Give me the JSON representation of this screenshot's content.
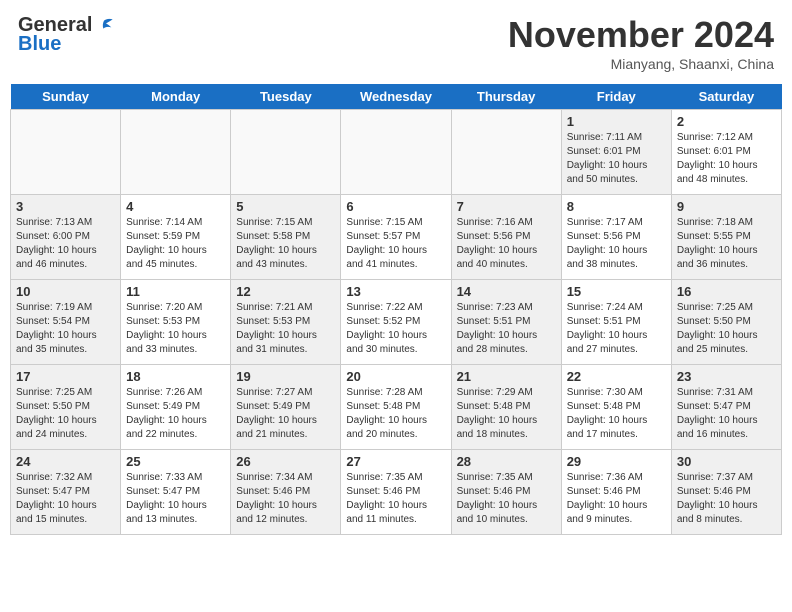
{
  "header": {
    "logo_general": "General",
    "logo_blue": "Blue",
    "month_title": "November 2024",
    "location": "Mianyang, Shaanxi, China"
  },
  "days_of_week": [
    "Sunday",
    "Monday",
    "Tuesday",
    "Wednesday",
    "Thursday",
    "Friday",
    "Saturday"
  ],
  "weeks": [
    [
      {
        "day": "",
        "info": "",
        "empty": true
      },
      {
        "day": "",
        "info": "",
        "empty": true
      },
      {
        "day": "",
        "info": "",
        "empty": true
      },
      {
        "day": "",
        "info": "",
        "empty": true
      },
      {
        "day": "",
        "info": "",
        "empty": true
      },
      {
        "day": "1",
        "info": "Sunrise: 7:11 AM\nSunset: 6:01 PM\nDaylight: 10 hours\nand 50 minutes.",
        "shaded": true
      },
      {
        "day": "2",
        "info": "Sunrise: 7:12 AM\nSunset: 6:01 PM\nDaylight: 10 hours\nand 48 minutes.",
        "shaded": false
      }
    ],
    [
      {
        "day": "3",
        "info": "Sunrise: 7:13 AM\nSunset: 6:00 PM\nDaylight: 10 hours\nand 46 minutes.",
        "shaded": true
      },
      {
        "day": "4",
        "info": "Sunrise: 7:14 AM\nSunset: 5:59 PM\nDaylight: 10 hours\nand 45 minutes.",
        "shaded": false
      },
      {
        "day": "5",
        "info": "Sunrise: 7:15 AM\nSunset: 5:58 PM\nDaylight: 10 hours\nand 43 minutes.",
        "shaded": true
      },
      {
        "day": "6",
        "info": "Sunrise: 7:15 AM\nSunset: 5:57 PM\nDaylight: 10 hours\nand 41 minutes.",
        "shaded": false
      },
      {
        "day": "7",
        "info": "Sunrise: 7:16 AM\nSunset: 5:56 PM\nDaylight: 10 hours\nand 40 minutes.",
        "shaded": true
      },
      {
        "day": "8",
        "info": "Sunrise: 7:17 AM\nSunset: 5:56 PM\nDaylight: 10 hours\nand 38 minutes.",
        "shaded": false
      },
      {
        "day": "9",
        "info": "Sunrise: 7:18 AM\nSunset: 5:55 PM\nDaylight: 10 hours\nand 36 minutes.",
        "shaded": true
      }
    ],
    [
      {
        "day": "10",
        "info": "Sunrise: 7:19 AM\nSunset: 5:54 PM\nDaylight: 10 hours\nand 35 minutes.",
        "shaded": true
      },
      {
        "day": "11",
        "info": "Sunrise: 7:20 AM\nSunset: 5:53 PM\nDaylight: 10 hours\nand 33 minutes.",
        "shaded": false
      },
      {
        "day": "12",
        "info": "Sunrise: 7:21 AM\nSunset: 5:53 PM\nDaylight: 10 hours\nand 31 minutes.",
        "shaded": true
      },
      {
        "day": "13",
        "info": "Sunrise: 7:22 AM\nSunset: 5:52 PM\nDaylight: 10 hours\nand 30 minutes.",
        "shaded": false
      },
      {
        "day": "14",
        "info": "Sunrise: 7:23 AM\nSunset: 5:51 PM\nDaylight: 10 hours\nand 28 minutes.",
        "shaded": true
      },
      {
        "day": "15",
        "info": "Sunrise: 7:24 AM\nSunset: 5:51 PM\nDaylight: 10 hours\nand 27 minutes.",
        "shaded": false
      },
      {
        "day": "16",
        "info": "Sunrise: 7:25 AM\nSunset: 5:50 PM\nDaylight: 10 hours\nand 25 minutes.",
        "shaded": true
      }
    ],
    [
      {
        "day": "17",
        "info": "Sunrise: 7:25 AM\nSunset: 5:50 PM\nDaylight: 10 hours\nand 24 minutes.",
        "shaded": true
      },
      {
        "day": "18",
        "info": "Sunrise: 7:26 AM\nSunset: 5:49 PM\nDaylight: 10 hours\nand 22 minutes.",
        "shaded": false
      },
      {
        "day": "19",
        "info": "Sunrise: 7:27 AM\nSunset: 5:49 PM\nDaylight: 10 hours\nand 21 minutes.",
        "shaded": true
      },
      {
        "day": "20",
        "info": "Sunrise: 7:28 AM\nSunset: 5:48 PM\nDaylight: 10 hours\nand 20 minutes.",
        "shaded": false
      },
      {
        "day": "21",
        "info": "Sunrise: 7:29 AM\nSunset: 5:48 PM\nDaylight: 10 hours\nand 18 minutes.",
        "shaded": true
      },
      {
        "day": "22",
        "info": "Sunrise: 7:30 AM\nSunset: 5:48 PM\nDaylight: 10 hours\nand 17 minutes.",
        "shaded": false
      },
      {
        "day": "23",
        "info": "Sunrise: 7:31 AM\nSunset: 5:47 PM\nDaylight: 10 hours\nand 16 minutes.",
        "shaded": true
      }
    ],
    [
      {
        "day": "24",
        "info": "Sunrise: 7:32 AM\nSunset: 5:47 PM\nDaylight: 10 hours\nand 15 minutes.",
        "shaded": true
      },
      {
        "day": "25",
        "info": "Sunrise: 7:33 AM\nSunset: 5:47 PM\nDaylight: 10 hours\nand 13 minutes.",
        "shaded": false
      },
      {
        "day": "26",
        "info": "Sunrise: 7:34 AM\nSunset: 5:46 PM\nDaylight: 10 hours\nand 12 minutes.",
        "shaded": true
      },
      {
        "day": "27",
        "info": "Sunrise: 7:35 AM\nSunset: 5:46 PM\nDaylight: 10 hours\nand 11 minutes.",
        "shaded": false
      },
      {
        "day": "28",
        "info": "Sunrise: 7:35 AM\nSunset: 5:46 PM\nDaylight: 10 hours\nand 10 minutes.",
        "shaded": true
      },
      {
        "day": "29",
        "info": "Sunrise: 7:36 AM\nSunset: 5:46 PM\nDaylight: 10 hours\nand 9 minutes.",
        "shaded": false
      },
      {
        "day": "30",
        "info": "Sunrise: 7:37 AM\nSunset: 5:46 PM\nDaylight: 10 hours\nand 8 minutes.",
        "shaded": true
      }
    ]
  ]
}
